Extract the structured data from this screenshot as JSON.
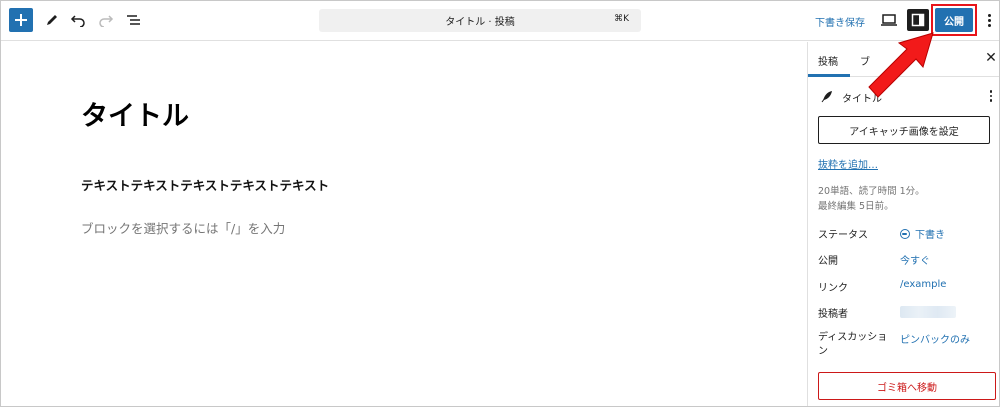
{
  "toolbar": {
    "command_title": "タイトル · 投稿",
    "command_shortcut": "⌘K",
    "save_draft": "下書き保存",
    "publish": "公開"
  },
  "editor": {
    "title": "タイトル",
    "paragraph": "テキストテキストテキストテキストテキスト",
    "placeholder": "ブロックを選択するには「/」を入力"
  },
  "sidebar": {
    "tabs": {
      "post": "投稿",
      "block": "ブ"
    },
    "post_title": "タイトル",
    "featured_image": "アイキャッチ画像を設定",
    "excerpt": "抜粋を追加…",
    "meta": {
      "word_count": "20単語、読了時間 1分。",
      "last_edited": "最終編集 5日前。"
    },
    "rows": [
      {
        "label": "ステータス",
        "value": "下書き"
      },
      {
        "label": "公開",
        "value": "今すぐ"
      },
      {
        "label": "リンク",
        "value": "/example"
      },
      {
        "label": "投稿者",
        "value": ""
      },
      {
        "label": "ディスカッション",
        "value": "ピンバックのみ"
      }
    ],
    "trash": "ゴミ箱へ移動"
  },
  "colors": {
    "accent": "#2271b1",
    "highlight": "#e8141a",
    "danger": "#cc1818"
  },
  "icons": {
    "add": "plus-icon",
    "tools": "pencil-icon",
    "undo": "undo-icon",
    "redo": "redo-icon",
    "outline": "list-view-icon",
    "preview": "laptop-icon",
    "settings": "sidebar-toggle-icon",
    "options": "more-vertical-icon",
    "close": "close-icon",
    "post": "quill-icon",
    "status": "draft-status-icon"
  }
}
